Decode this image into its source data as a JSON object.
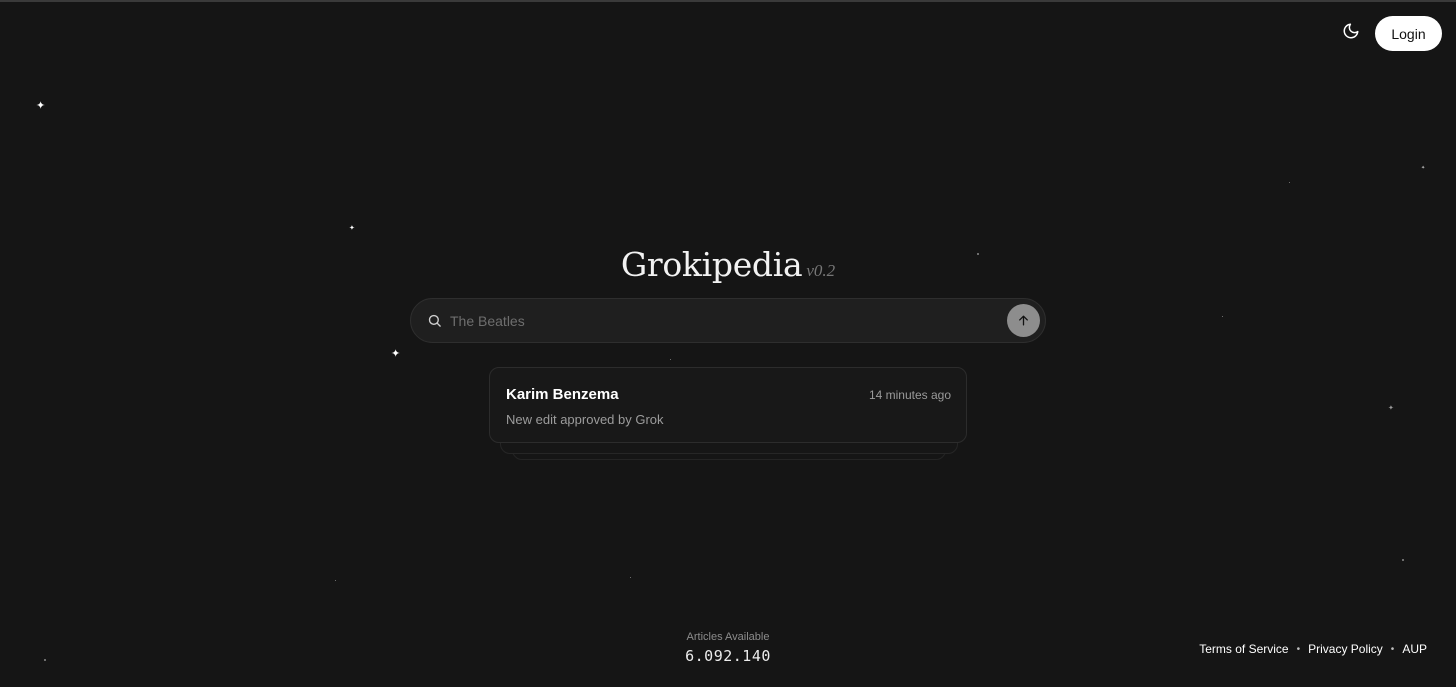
{
  "header": {
    "theme_icon": "moon-icon",
    "login_label": "Login"
  },
  "brand": {
    "name": "Grokipedia",
    "version": "v0.2"
  },
  "search": {
    "placeholder": "The Beatles",
    "value": "",
    "search_icon": "search-icon",
    "submit_icon": "arrow-up-icon"
  },
  "recent_edit": {
    "title": "Karim Benzema",
    "time": "14 minutes ago",
    "description": "New edit approved by Grok"
  },
  "stats": {
    "label": "Articles Available",
    "value": "6.092.140"
  },
  "footer": {
    "links": [
      {
        "label": "Terms of Service"
      },
      {
        "label": "Privacy Policy"
      },
      {
        "label": "AUP"
      }
    ],
    "separator": "•"
  },
  "colors": {
    "background": "#151515",
    "login_bg": "#ffffff",
    "submit_bg": "#8d8d8d",
    "card_border": "#2c2c2c"
  }
}
